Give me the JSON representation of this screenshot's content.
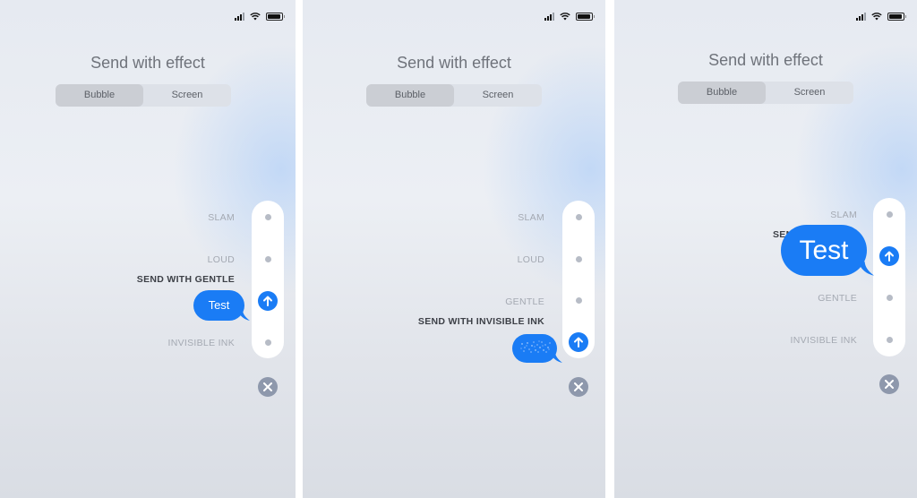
{
  "panels": [
    {
      "title": "Send with effect",
      "segment": {
        "options": [
          "Bubble",
          "Screen"
        ],
        "selected": "Bubble"
      },
      "effects": [
        {
          "label": "SLAM",
          "active": false
        },
        {
          "label": "LOUD",
          "active": false
        },
        {
          "label": "SEND WITH GENTLE",
          "active": true
        },
        {
          "label": "INVISIBLE INK",
          "active": false
        }
      ],
      "bubble_text": "Test",
      "selected_effect": "Gentle"
    },
    {
      "title": "Send with effect",
      "segment": {
        "options": [
          "Bubble",
          "Screen"
        ],
        "selected": "Bubble"
      },
      "effects": [
        {
          "label": "SLAM",
          "active": false
        },
        {
          "label": "LOUD",
          "active": false
        },
        {
          "label": "GENTLE",
          "active": false
        },
        {
          "label": "SEND WITH INVISIBLE INK",
          "active": true
        }
      ],
      "bubble_text": "",
      "selected_effect": "Invisible Ink"
    },
    {
      "title": "Send with effect",
      "segment": {
        "options": [
          "Bubble",
          "Screen"
        ],
        "selected": "Bubble"
      },
      "effects": [
        {
          "label": "SLAM",
          "active": false
        },
        {
          "label": "SEND WITH LOUD",
          "active": true
        },
        {
          "label": "GENTLE",
          "active": false
        },
        {
          "label": "INVISIBLE INK",
          "active": false
        }
      ],
      "bubble_text": "Test",
      "selected_effect": "Loud"
    }
  ],
  "colors": {
    "accent": "#1a7cf5",
    "close": "#8e98ac",
    "label": "#a4a9b2",
    "label_active": "#3d4047"
  },
  "icons": {
    "send": "arrow-up-icon",
    "close": "close-x-icon",
    "signal": "cellular-signal-icon",
    "wifi": "wifi-icon",
    "battery": "battery-icon"
  }
}
